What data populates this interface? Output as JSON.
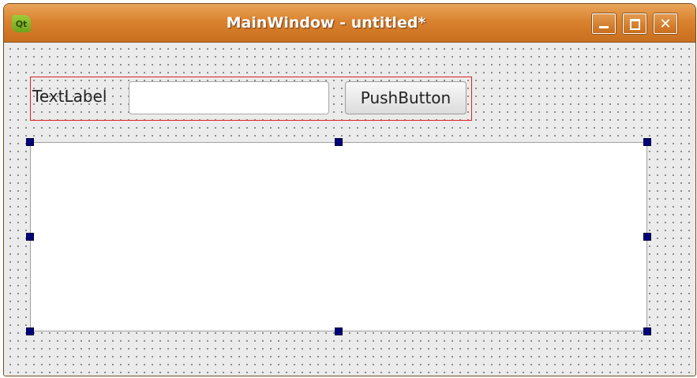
{
  "window": {
    "title": "MainWindow - untitled*",
    "app_icon_text": "Qt",
    "minimize_icon": "minimize-icon",
    "maximize_icon": "maximize-icon",
    "close_icon": "close-icon",
    "close_glyph": "✕"
  },
  "form": {
    "label_text": "TextLabel",
    "line_edit_value": "",
    "button_label": "PushButton"
  },
  "colors": {
    "titlebar": "#d9822f",
    "layout_border": "#e02020",
    "selection_handle": "#00007a",
    "canvas": "#ebebeb"
  }
}
